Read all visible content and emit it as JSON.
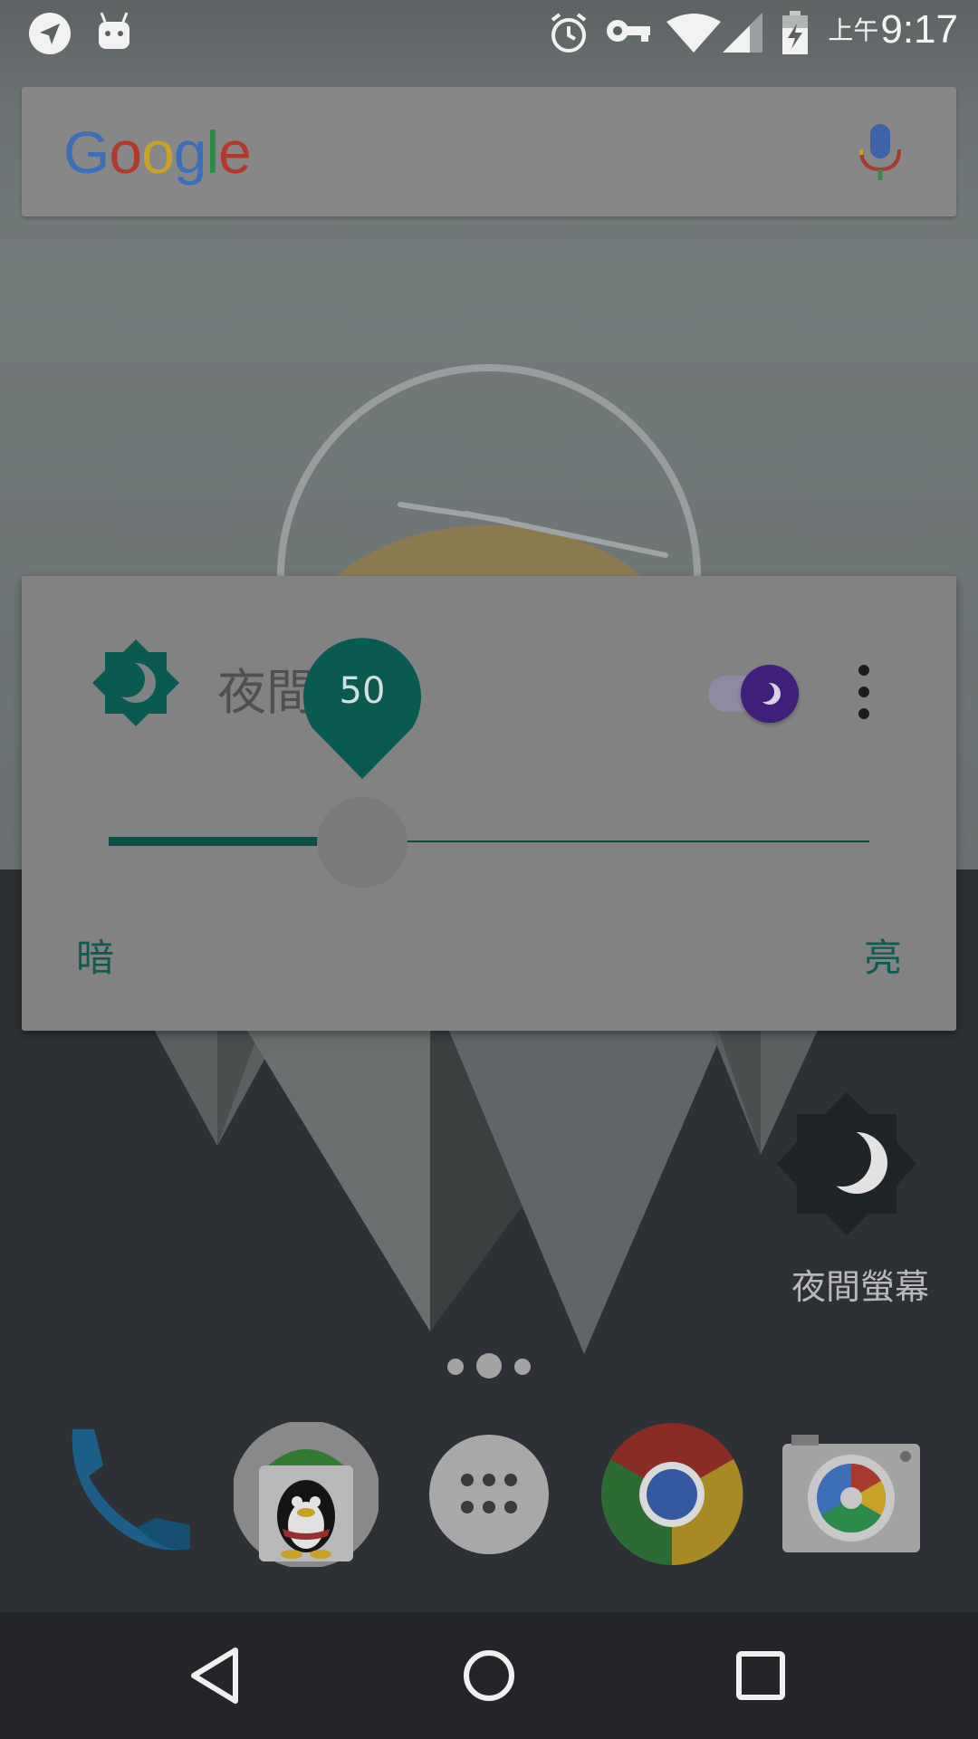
{
  "status_bar": {
    "time_ampm": "上午",
    "time": "9:17",
    "icons": [
      "send-icon",
      "android-icon",
      "alarm-icon",
      "vpn-key-icon",
      "wifi-icon",
      "cell-signal-icon",
      "battery-charging-icon"
    ]
  },
  "search": {
    "logo_letters": [
      {
        "ch": "G",
        "color": "#3d6fb8"
      },
      {
        "ch": "o",
        "color": "#b03a2e"
      },
      {
        "ch": "o",
        "color": "#c8a227"
      },
      {
        "ch": "g",
        "color": "#3d6fb8"
      },
      {
        "ch": "l",
        "color": "#2e8a4a"
      },
      {
        "ch": "e",
        "color": "#b03a2e"
      }
    ]
  },
  "dialog": {
    "title": "夜間螢幕",
    "toggle_on": true,
    "slider_value": "50",
    "slider_fraction": 0.333,
    "label_dark": "暗",
    "label_bright": "亮"
  },
  "shortcut": {
    "label": "夜間螢幕"
  },
  "page_indicator": {
    "count": 3,
    "active": 1
  },
  "dock": {
    "apps": [
      "phone-app-icon",
      "qq-app-icon",
      "app-drawer-icon",
      "chrome-app-icon",
      "camera-app-icon"
    ]
  },
  "colors": {
    "accent_teal": "#0b5a52",
    "toggle_purple": "#3f1f79",
    "dialog_bg": "#828282"
  }
}
